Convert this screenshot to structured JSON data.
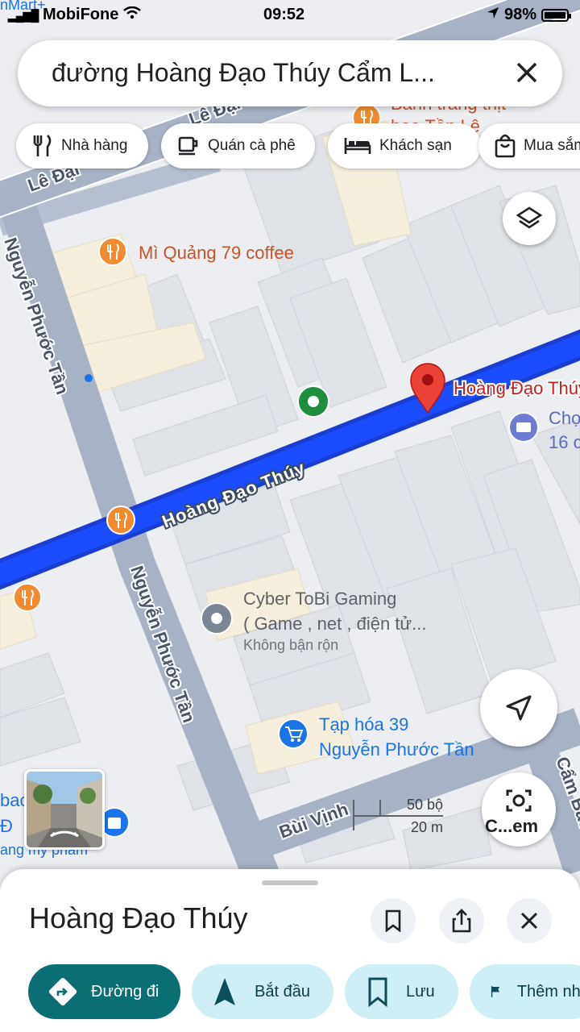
{
  "status_bar": {
    "carrier": "MobiFone",
    "time": "09:52",
    "battery": "98%"
  },
  "search": {
    "query": "đường Hoàng Đạo Thúy Cẩm L..."
  },
  "chips": [
    {
      "label": "Nhà hàng",
      "icon": "fork-knife-icon"
    },
    {
      "label": "Quán cà phê",
      "icon": "coffee-cup-icon"
    },
    {
      "label": "Khách sạn",
      "icon": "bed-icon"
    },
    {
      "label": "Mua sắm",
      "icon": "shopping-bag-icon"
    }
  ],
  "map": {
    "streets": {
      "main": "Hoàng Đạo Thúy",
      "side_left": "Nguyễn Phước Tần",
      "side_bottom": "Nguyễn Phước Tần",
      "top_left_1": "Lê Đại",
      "top_left_2": "Lê Đại",
      "bottom": "Bùi Vịnh",
      "right": "Cẩm Bắc"
    },
    "pois": {
      "mi_quang": "Mì Quảng 79 coffee",
      "banh_trang": "Bánh tráng thịt",
      "banh_trang_2": "heo Tần Lê",
      "cyber_1": "Cyber ToBi Gaming",
      "cyber_2": "( Game , net , điện tử...",
      "cyber_status": "Không bận rộn",
      "taphoa_1": "Tạp hóa 39",
      "taphoa_2": "Nguyễn Phước Tần",
      "cho_1": "Chợ",
      "cho_2": "16 c",
      "pin_label": "Hoàng Đạo Thúy",
      "left_edge_1": "bac",
      "left_edge_2": "Đ",
      "left_edge_3": "ang mỹ phẩm",
      "top_corner": "nMart+"
    },
    "scale": {
      "imperial": "50 bộ",
      "metric": "20 m"
    },
    "lens_label": "C...em",
    "colors": {
      "route": "#1a4dff",
      "pin": "#ea4335",
      "poi_food": "#f28b30"
    }
  },
  "sheet": {
    "title": "Hoàng Đạo Thúy",
    "actions": [
      {
        "label": "Đường đi",
        "icon": "directions-icon"
      },
      {
        "label": "Bắt đầu",
        "icon": "navigation-arrow-icon"
      },
      {
        "label": "Lưu",
        "icon": "bookmark-icon"
      },
      {
        "label": "Thêm nhãn",
        "icon": "flag-icon"
      }
    ]
  }
}
